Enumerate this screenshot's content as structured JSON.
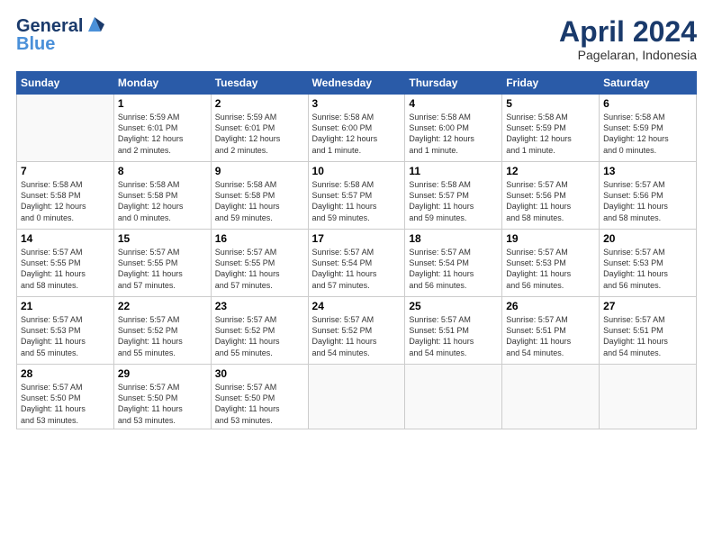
{
  "header": {
    "logo_line1": "General",
    "logo_line2": "Blue",
    "title": "April 2024",
    "subtitle": "Pagelaran, Indonesia"
  },
  "calendar": {
    "headers": [
      "Sunday",
      "Monday",
      "Tuesday",
      "Wednesday",
      "Thursday",
      "Friday",
      "Saturday"
    ],
    "weeks": [
      [
        {
          "day": "",
          "info": ""
        },
        {
          "day": "1",
          "info": "Sunrise: 5:59 AM\nSunset: 6:01 PM\nDaylight: 12 hours\nand 2 minutes."
        },
        {
          "day": "2",
          "info": "Sunrise: 5:59 AM\nSunset: 6:01 PM\nDaylight: 12 hours\nand 2 minutes."
        },
        {
          "day": "3",
          "info": "Sunrise: 5:58 AM\nSunset: 6:00 PM\nDaylight: 12 hours\nand 1 minute."
        },
        {
          "day": "4",
          "info": "Sunrise: 5:58 AM\nSunset: 6:00 PM\nDaylight: 12 hours\nand 1 minute."
        },
        {
          "day": "5",
          "info": "Sunrise: 5:58 AM\nSunset: 5:59 PM\nDaylight: 12 hours\nand 1 minute."
        },
        {
          "day": "6",
          "info": "Sunrise: 5:58 AM\nSunset: 5:59 PM\nDaylight: 12 hours\nand 0 minutes."
        }
      ],
      [
        {
          "day": "7",
          "info": "Sunrise: 5:58 AM\nSunset: 5:58 PM\nDaylight: 12 hours\nand 0 minutes."
        },
        {
          "day": "8",
          "info": "Sunrise: 5:58 AM\nSunset: 5:58 PM\nDaylight: 12 hours\nand 0 minutes."
        },
        {
          "day": "9",
          "info": "Sunrise: 5:58 AM\nSunset: 5:58 PM\nDaylight: 11 hours\nand 59 minutes."
        },
        {
          "day": "10",
          "info": "Sunrise: 5:58 AM\nSunset: 5:57 PM\nDaylight: 11 hours\nand 59 minutes."
        },
        {
          "day": "11",
          "info": "Sunrise: 5:58 AM\nSunset: 5:57 PM\nDaylight: 11 hours\nand 59 minutes."
        },
        {
          "day": "12",
          "info": "Sunrise: 5:57 AM\nSunset: 5:56 PM\nDaylight: 11 hours\nand 58 minutes."
        },
        {
          "day": "13",
          "info": "Sunrise: 5:57 AM\nSunset: 5:56 PM\nDaylight: 11 hours\nand 58 minutes."
        }
      ],
      [
        {
          "day": "14",
          "info": "Sunrise: 5:57 AM\nSunset: 5:55 PM\nDaylight: 11 hours\nand 58 minutes."
        },
        {
          "day": "15",
          "info": "Sunrise: 5:57 AM\nSunset: 5:55 PM\nDaylight: 11 hours\nand 57 minutes."
        },
        {
          "day": "16",
          "info": "Sunrise: 5:57 AM\nSunset: 5:55 PM\nDaylight: 11 hours\nand 57 minutes."
        },
        {
          "day": "17",
          "info": "Sunrise: 5:57 AM\nSunset: 5:54 PM\nDaylight: 11 hours\nand 57 minutes."
        },
        {
          "day": "18",
          "info": "Sunrise: 5:57 AM\nSunset: 5:54 PM\nDaylight: 11 hours\nand 56 minutes."
        },
        {
          "day": "19",
          "info": "Sunrise: 5:57 AM\nSunset: 5:53 PM\nDaylight: 11 hours\nand 56 minutes."
        },
        {
          "day": "20",
          "info": "Sunrise: 5:57 AM\nSunset: 5:53 PM\nDaylight: 11 hours\nand 56 minutes."
        }
      ],
      [
        {
          "day": "21",
          "info": "Sunrise: 5:57 AM\nSunset: 5:53 PM\nDaylight: 11 hours\nand 55 minutes."
        },
        {
          "day": "22",
          "info": "Sunrise: 5:57 AM\nSunset: 5:52 PM\nDaylight: 11 hours\nand 55 minutes."
        },
        {
          "day": "23",
          "info": "Sunrise: 5:57 AM\nSunset: 5:52 PM\nDaylight: 11 hours\nand 55 minutes."
        },
        {
          "day": "24",
          "info": "Sunrise: 5:57 AM\nSunset: 5:52 PM\nDaylight: 11 hours\nand 54 minutes."
        },
        {
          "day": "25",
          "info": "Sunrise: 5:57 AM\nSunset: 5:51 PM\nDaylight: 11 hours\nand 54 minutes."
        },
        {
          "day": "26",
          "info": "Sunrise: 5:57 AM\nSunset: 5:51 PM\nDaylight: 11 hours\nand 54 minutes."
        },
        {
          "day": "27",
          "info": "Sunrise: 5:57 AM\nSunset: 5:51 PM\nDaylight: 11 hours\nand 54 minutes."
        }
      ],
      [
        {
          "day": "28",
          "info": "Sunrise: 5:57 AM\nSunset: 5:50 PM\nDaylight: 11 hours\nand 53 minutes."
        },
        {
          "day": "29",
          "info": "Sunrise: 5:57 AM\nSunset: 5:50 PM\nDaylight: 11 hours\nand 53 minutes."
        },
        {
          "day": "30",
          "info": "Sunrise: 5:57 AM\nSunset: 5:50 PM\nDaylight: 11 hours\nand 53 minutes."
        },
        {
          "day": "",
          "info": ""
        },
        {
          "day": "",
          "info": ""
        },
        {
          "day": "",
          "info": ""
        },
        {
          "day": "",
          "info": ""
        }
      ]
    ]
  }
}
